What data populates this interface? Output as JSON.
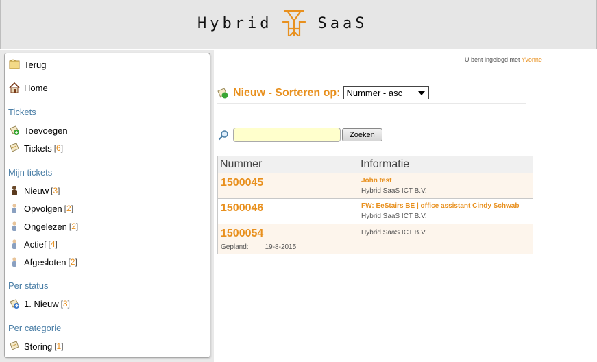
{
  "header": {
    "logo_left": "Hybrid",
    "logo_right": "SaaS"
  },
  "sidebar": {
    "back_label": "Terug",
    "home_label": "Home",
    "sections": {
      "tickets": "Tickets",
      "my_tickets": "Mijn tickets",
      "per_status": "Per status",
      "per_category": "Per categorie"
    },
    "items": {
      "add": {
        "label": "Toevoegen"
      },
      "tickets": {
        "label": "Tickets",
        "count": "6"
      },
      "new": {
        "label": "Nieuw",
        "count": "3"
      },
      "follow_up": {
        "label": "Opvolgen",
        "count": "2"
      },
      "unread": {
        "label": "Ongelezen",
        "count": "2"
      },
      "active": {
        "label": "Actief",
        "count": "4"
      },
      "closed": {
        "label": "Afgesloten",
        "count": "2"
      },
      "status_new": {
        "label": "1. Nieuw",
        "count": "3"
      },
      "cat_storing": {
        "label": "Storing",
        "count": "1"
      }
    }
  },
  "login": {
    "prefix": "U bent ingelogd met",
    "user": "Yvonne"
  },
  "main": {
    "title": "Nieuw - Sorteren op:",
    "sort_selected": "Nummer - asc",
    "search": {
      "value": "",
      "button": "Zoeken"
    },
    "table": {
      "headers": [
        "Nummer",
        "Informatie"
      ],
      "rows": [
        {
          "number": "1500045",
          "subject": "John test",
          "company": "Hybrid SaaS ICT B.V."
        },
        {
          "number": "1500046",
          "subject": "FW: EeStairs BE | office assistant Cindy Schwab",
          "company": "Hybrid SaaS ICT B.V."
        },
        {
          "number": "1500054",
          "subject": "",
          "company": "Hybrid SaaS ICT B.V.",
          "planned_label": "Gepland:",
          "planned_date": "19-8-2015"
        }
      ]
    }
  },
  "colors": {
    "accent": "#e8901e",
    "section": "#4a7ea6",
    "search_bg": "#ffffcc"
  }
}
